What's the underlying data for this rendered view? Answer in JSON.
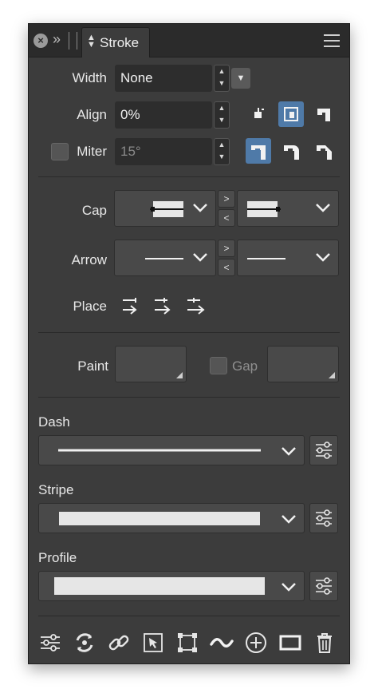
{
  "panel": {
    "tab_title": "Stroke",
    "accent_color": "#4f7aa8"
  },
  "width": {
    "label": "Width",
    "value": "None"
  },
  "align": {
    "label": "Align",
    "value": "0%",
    "selected_index": 1
  },
  "miter": {
    "label": "Miter",
    "value": "15°",
    "checked": false,
    "selected_join_index": 0
  },
  "cap": {
    "label": "Cap",
    "next_symbol": ">",
    "prev_symbol": "<"
  },
  "arrow": {
    "label": "Arrow",
    "next_symbol": ">",
    "prev_symbol": "<"
  },
  "place": {
    "label": "Place"
  },
  "paint": {
    "label": "Paint"
  },
  "gap": {
    "label": "Gap",
    "checked": false
  },
  "dash": {
    "label": "Dash"
  },
  "stripe": {
    "label": "Stripe"
  },
  "profile": {
    "label": "Profile"
  },
  "toolbar": {
    "icons": [
      "settings-sliders-icon",
      "convert-cycle-icon",
      "link-icon",
      "select-arrow-icon",
      "transform-box-icon",
      "wave-icon",
      "add-circle-icon",
      "rectangle-icon",
      "trash-icon"
    ]
  }
}
